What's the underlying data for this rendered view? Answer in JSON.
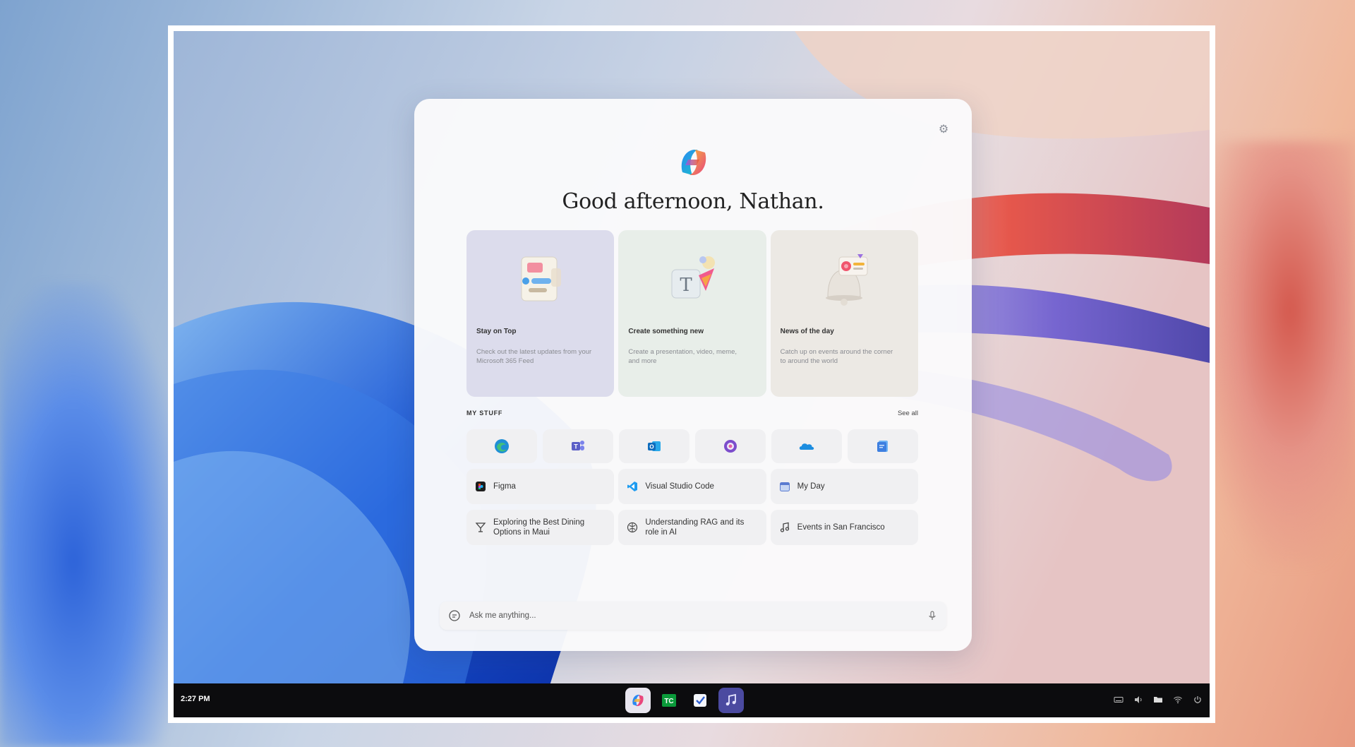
{
  "greeting": "Good afternoon, Nathan.",
  "cards": [
    {
      "title": "Stay on Top",
      "description": "Check out the latest updates from your Microsoft 365 Feed",
      "icon": "feed-illustration"
    },
    {
      "title": "Create something new",
      "description": "Create a presentation, video, meme, and more",
      "icon": "create-illustration"
    },
    {
      "title": "News of the day",
      "description": "Catch up on events around the corner to around the world",
      "icon": "news-bell-illustration"
    }
  ],
  "my_stuff": {
    "label": "MY STUFF",
    "see_all": "See all",
    "apps": [
      {
        "name": "edge-icon",
        "color": "#1f8fd6"
      },
      {
        "name": "teams-icon",
        "color": "#5b5fc7"
      },
      {
        "name": "outlook-icon",
        "color": "#0f6cbd"
      },
      {
        "name": "loop-icon",
        "color": "#7c4dcc"
      },
      {
        "name": "onedrive-icon",
        "color": "#1c8de0"
      },
      {
        "name": "copilot-pages-icon",
        "color": "#3e7fe0"
      }
    ],
    "items": [
      {
        "label": "Figma",
        "icon": "figma-icon"
      },
      {
        "label": "Visual Studio Code",
        "icon": "vscode-icon"
      },
      {
        "label": "My Day",
        "icon": "calendar-icon"
      },
      {
        "label": "Exploring the Best Dining Options in Maui",
        "icon": "cocktail-icon"
      },
      {
        "label": "Understanding RAG and its role in AI",
        "icon": "brain-icon"
      },
      {
        "label": "Events in San Francisco",
        "icon": "music-note-icon"
      }
    ]
  },
  "ask": {
    "placeholder": "Ask me anything..."
  },
  "taskbar": {
    "time": "2:27 PM",
    "apps": [
      "copilot-icon",
      "techcrunch-icon",
      "todo-icon",
      "music-app-icon"
    ],
    "tray": [
      "keyboard-icon",
      "volume-icon",
      "folder-icon",
      "wifi-icon",
      "power-icon"
    ]
  }
}
